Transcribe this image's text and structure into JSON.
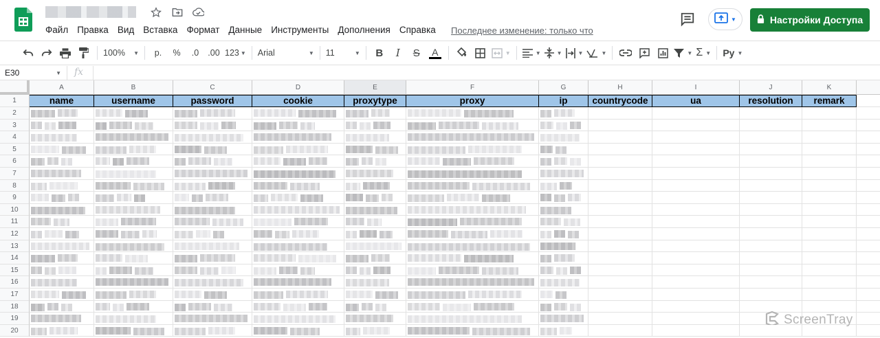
{
  "app": {
    "menu": [
      "Файл",
      "Правка",
      "Вид",
      "Вставка",
      "Формат",
      "Данные",
      "Инструменты",
      "Дополнения",
      "Справка"
    ],
    "last_edit": "Последнее изменение: только что",
    "share_label": "Настройки Доступа",
    "accent": "#188038"
  },
  "toolbar": {
    "zoom": "100%",
    "currency": "р.",
    "percent": "%",
    "dec_less": ".0",
    "dec_more": ".00",
    "format_more": "123",
    "font": "Arial",
    "font_size": "11"
  },
  "formula": {
    "cell_ref": "E30",
    "fx": "fx"
  },
  "sheet": {
    "columns": [
      "A",
      "B",
      "C",
      "D",
      "E",
      "F",
      "G",
      "H",
      "I",
      "J",
      "K"
    ],
    "selected_column": "E",
    "headers": [
      "name",
      "username",
      "password",
      "cookie",
      "proxytype",
      "proxy",
      "ip",
      "countrycode",
      "ua",
      "resolution",
      "remark"
    ],
    "header_fill": "#9fc5e8",
    "rows": [
      "1",
      "2",
      "3",
      "4",
      "5",
      "6",
      "7",
      "8",
      "9",
      "10",
      "11",
      "12",
      "13",
      "14",
      "15",
      "16",
      "17",
      "18",
      "19",
      "20"
    ]
  },
  "watermark": "ScreenTray"
}
